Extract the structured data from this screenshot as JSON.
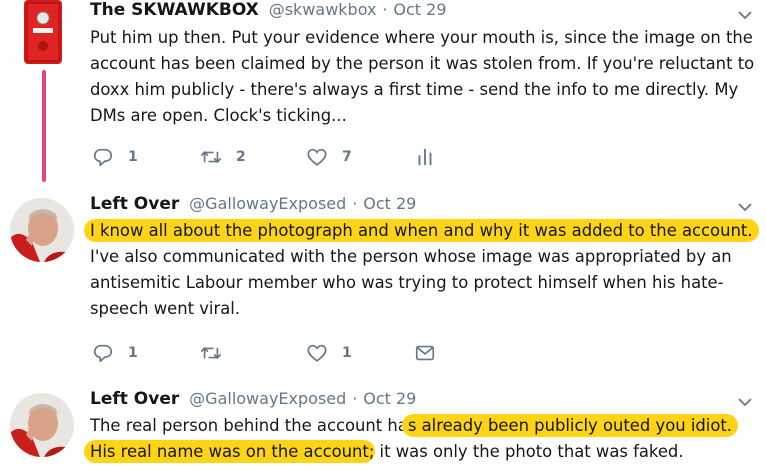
{
  "tweets": [
    {
      "name": "The SKWAWKBOX",
      "handle": "@skwawkbox",
      "separator": "·",
      "time": "Oct 29",
      "lines": [
        [
          {
            "t": "Put him up then. Put your evidence where your mouth is, since the image on the",
            "h": false
          }
        ],
        [
          {
            "t": "account has been claimed by the person it was stolen from. If you're reluctant to",
            "h": false
          }
        ],
        [
          {
            "t": "doxx him publicly - there's always a first time - send the info to me directly. My",
            "h": false
          }
        ],
        [
          {
            "t": "DMs are open. Clock's ticking...",
            "h": false
          }
        ]
      ],
      "actions": {
        "reply": "1",
        "retweet": "2",
        "like": "7",
        "extra_icon": "analytics-icon"
      }
    },
    {
      "name": "Left Over",
      "handle": "@GallowayExposed",
      "separator": "·",
      "time": "Oct 29",
      "lines": [
        [
          {
            "t": "I know all about the photograph and when and why it was added to the account.",
            "h": true
          }
        ],
        [
          {
            "t": "I've also communicated with the person whose image was appropriated by an",
            "h": false
          }
        ],
        [
          {
            "t": "antisemitic Labour member who was trying to protect himself when his hate-",
            "h": false
          }
        ],
        [
          {
            "t": "speech went viral.",
            "h": false
          }
        ]
      ],
      "actions": {
        "reply": "1",
        "retweet": "",
        "like": "1",
        "extra_icon": "message-icon"
      }
    },
    {
      "name": "Left Over",
      "handle": "@GallowayExposed",
      "separator": "·",
      "time": "Oct 29",
      "lines": [
        [
          {
            "t": "The real person behind the account ha",
            "h": false
          },
          {
            "t": "s already been publicly outed you idiot.",
            "h": true
          }
        ],
        [
          {
            "t": "His real name was on the account",
            "h": true
          },
          {
            "t": "; it was only the photo that was faked.",
            "h": false
          }
        ]
      ],
      "actions": null
    }
  ],
  "colors": {
    "text": "#14171a",
    "secondary": "#657786",
    "highlight": "#ffd316",
    "thread_line": "#e0457e"
  },
  "icons": [
    "red-alarm-box-avatar",
    "reply-icon",
    "retweet-icon",
    "heart-icon",
    "analytics-icon",
    "message-icon",
    "chevron-down-icon"
  ]
}
